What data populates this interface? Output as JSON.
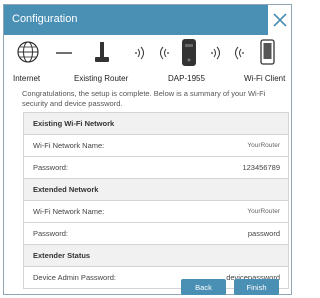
{
  "window": {
    "title": "Configuration"
  },
  "topology": {
    "internet_label": "Internet",
    "router_label": "Existing Router",
    "extender_label": "DAP-1955",
    "client_label": "Wi-Fi Client"
  },
  "message": "Congratulations, the setup is complete. Below is a summary of your Wi-Fi security and device password.",
  "existing_network": {
    "heading": "Existing Wi-Fi Network",
    "ssid_label": "Wi-Fi Network Name:",
    "ssid_value": "YourRouter",
    "password_label": "Password:",
    "password_value": "123456789"
  },
  "extended_network": {
    "heading": "Extended Network",
    "ssid_label": "Wi-Fi Network Name:",
    "ssid_value": "YourRouter",
    "password_label": "Password:",
    "password_value": "password"
  },
  "extender_status": {
    "heading": "Extender Status",
    "admin_password_label": "Device Admin Password:",
    "admin_password_value": "devicepassword"
  },
  "buttons": {
    "back": "Back",
    "finish": "Finish"
  },
  "colors": {
    "accent": "#4a90b5",
    "border": "#d4d4d4",
    "section_bg": "#f1f1f1"
  }
}
